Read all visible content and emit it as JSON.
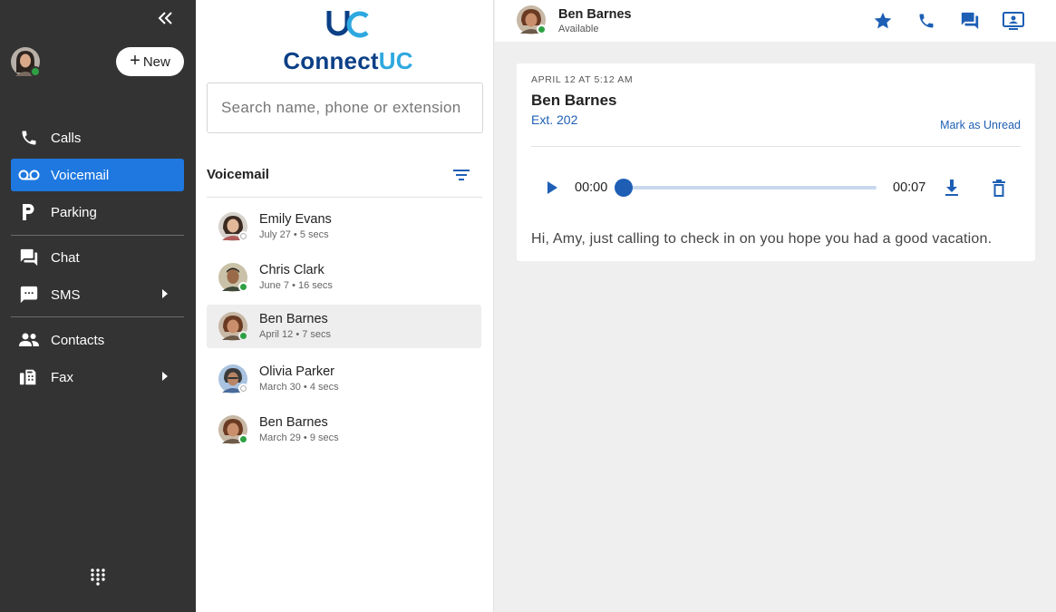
{
  "sidebar": {
    "new_label": "New",
    "nav": [
      {
        "label": "Calls",
        "icon": "phone-icon"
      },
      {
        "label": "Voicemail",
        "icon": "voicemail-icon",
        "active": true
      },
      {
        "label": "Parking",
        "icon": "parking-icon"
      },
      {
        "label": "Chat",
        "icon": "chat-icon"
      },
      {
        "label": "SMS",
        "icon": "sms-icon",
        "submenu": true
      },
      {
        "label": "Contacts",
        "icon": "contacts-icon"
      },
      {
        "label": "Fax",
        "icon": "fax-icon",
        "submenu": true
      }
    ]
  },
  "logo": {
    "text_main": "Connect",
    "text_accent": "UC"
  },
  "search": {
    "placeholder": "Search name, phone or extension",
    "value": ""
  },
  "list": {
    "title": "Voicemail",
    "items": [
      {
        "name": "Emily Evans",
        "meta": "July 27 • 5 secs",
        "presence": "offline"
      },
      {
        "name": "Chris Clark",
        "meta": "June 7 • 16 secs",
        "presence": "available"
      },
      {
        "name": "Ben Barnes",
        "meta": "April 12 • 7 secs",
        "presence": "available",
        "selected": true
      },
      {
        "name": "Olivia Parker",
        "meta": "March 30 • 4 secs",
        "presence": "offline"
      },
      {
        "name": "Ben Barnes",
        "meta": "March 29 • 9 secs",
        "presence": "available"
      }
    ]
  },
  "header": {
    "name": "Ben Barnes",
    "status": "Available"
  },
  "detail": {
    "date": "APRIL 12 AT 5:12 AM",
    "name": "Ben Barnes",
    "extension": "Ext. 202",
    "mark_unread": "Mark as Unread",
    "time_current": "00:00",
    "time_total": "00:07",
    "progress": 0,
    "transcript": "Hi, Amy, just calling to check in on you hope you had a good vacation."
  },
  "colors": {
    "sidebar_bg": "#333333",
    "active_nav": "#1e78e0",
    "accent": "#1e5fb5",
    "available": "#2ea043"
  }
}
